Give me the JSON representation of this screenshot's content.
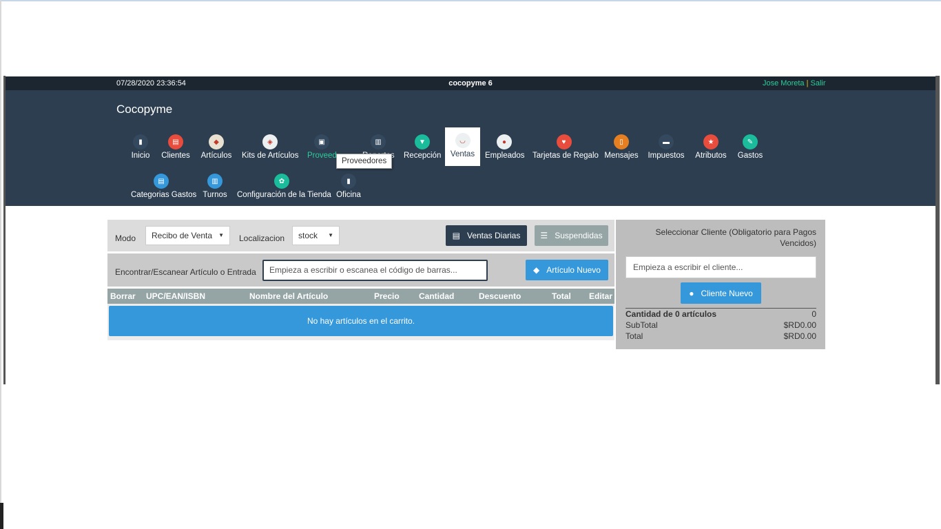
{
  "topbar": {
    "datetime": "07/28/2020 23:36:54",
    "store_name": "cocopyme 6",
    "user_name": "Jose Moreta",
    "separator": "|",
    "logout": "Salir"
  },
  "brand": "Cocopyme",
  "menu": [
    {
      "label": "Inicio",
      "icon": "home-icon",
      "color": "#34495e",
      "glyph": "▮"
    },
    {
      "label": "Clientes",
      "icon": "clients-icon",
      "color": "#e74c3c",
      "glyph": "▤"
    },
    {
      "label": "Artículos",
      "icon": "tag-icon",
      "color": "#e8e0d0",
      "glyph": "◆"
    },
    {
      "label": "Kits de Artículos",
      "icon": "layers-icon",
      "color": "#ecf0f1",
      "glyph": "◈"
    },
    {
      "label": "Proveedores",
      "icon": "briefcase-icon",
      "color": "#34495e",
      "glyph": "▣"
    },
    {
      "label": "Reportes",
      "icon": "chart-icon",
      "color": "#34495e",
      "glyph": "▥"
    },
    {
      "label": "Recepción",
      "icon": "cart-receive-icon",
      "color": "#1abc9c",
      "glyph": "▼"
    },
    {
      "label": "Ventas",
      "icon": "basket-icon",
      "color": "#ecf0f1",
      "glyph": "◡"
    },
    {
      "label": "Empleados",
      "icon": "user-icon",
      "color": "#ecf0f1",
      "glyph": "●"
    },
    {
      "label": "Tarjetas de Regalo",
      "icon": "heart-icon",
      "color": "#e74c3c",
      "glyph": "♥"
    },
    {
      "label": "Mensajes",
      "icon": "phone-icon",
      "color": "#e67e22",
      "glyph": "▯"
    },
    {
      "label": "Impuestos",
      "icon": "money-icon",
      "color": "#34495e",
      "glyph": "▬"
    },
    {
      "label": "Atributos",
      "icon": "star-icon",
      "color": "#e74c3c",
      "glyph": "★"
    },
    {
      "label": "Gastos",
      "icon": "edit-icon",
      "color": "#1abc9c",
      "glyph": "✎"
    },
    {
      "label": "Categorias Gastos",
      "icon": "clipboard-icon",
      "color": "#3498db",
      "glyph": "▤"
    },
    {
      "label": "Turnos",
      "icon": "shifts-icon",
      "color": "#3498db",
      "glyph": "▥"
    },
    {
      "label": "Configuración de la Tienda",
      "icon": "gear-icon",
      "color": "#1abc9c",
      "glyph": "✿"
    },
    {
      "label": "Oficina",
      "icon": "office-icon",
      "color": "#34495e",
      "glyph": "▮"
    }
  ],
  "tooltip": "Proveedores",
  "register": {
    "mode_label": "Modo",
    "mode_value": "Recibo de Venta",
    "location_label": "Localizacion",
    "location_value": "stock",
    "daily_sales": "Ventas Diarias",
    "suspended": "Suspendidas",
    "find_label": "Encontrar/Escanear Artículo o Entrada",
    "search_placeholder": "Empieza a escribir o escanea el código de barras...",
    "new_item": "Artículo Nuevo"
  },
  "cart": {
    "columns": [
      "Borrar",
      "UPC/EAN/ISBN",
      "Nombre del Artículo",
      "Precio",
      "Cantidad",
      "Descuento",
      "Total",
      "Editar"
    ],
    "empty_message": "No hay artículos en el carrito."
  },
  "customer": {
    "title": "Seleccionar Cliente (Obligatorio para Pagos Vencidos)",
    "placeholder": "Empieza a escribir el cliente...",
    "new_customer": "Cliente Nuevo"
  },
  "totals": [
    {
      "label": "Cantidad de 0 artículos",
      "value": "0"
    },
    {
      "label": "SubTotal",
      "value": "$RD0.00"
    },
    {
      "label": "Total",
      "value": "$RD0.00"
    }
  ]
}
